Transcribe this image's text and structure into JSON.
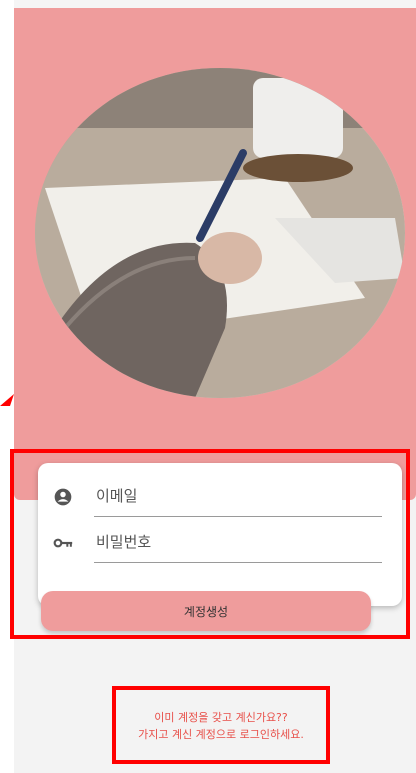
{
  "form": {
    "email_label": "이메일",
    "password_label": "비밀번호",
    "signup_button": "계정생성"
  },
  "login_prompt": {
    "line1": "이미 계정을 갖고 계신가요??",
    "line2": "가지고 계신 계정으로 로그인하세요."
  },
  "icons": {
    "email": "account-circle-icon",
    "password": "key-icon"
  },
  "colors": {
    "accent": "#ef9c9c",
    "annotation": "#ff0000",
    "link": "#e8504a"
  }
}
